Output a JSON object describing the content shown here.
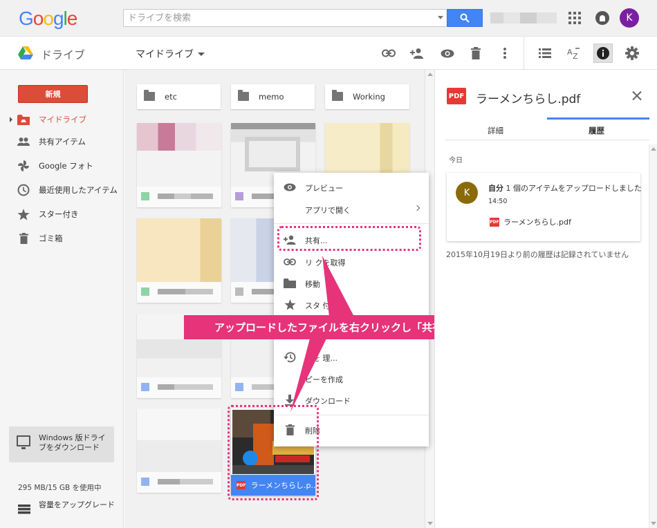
{
  "header": {
    "logo_letters": [
      {
        "ch": "G",
        "color": "#4285f4"
      },
      {
        "ch": "o",
        "color": "#ea4335"
      },
      {
        "ch": "o",
        "color": "#fbbc05"
      },
      {
        "ch": "g",
        "color": "#4285f4"
      },
      {
        "ch": "l",
        "color": "#34a853"
      },
      {
        "ch": "e",
        "color": "#ea4335"
      }
    ],
    "search_placeholder": "ドライブを検索",
    "avatar_letter": "K"
  },
  "toolbar": {
    "app_title": "ドライブ",
    "location": "マイドライブ",
    "icons": [
      "link-icon",
      "add-person-icon",
      "preview-eye-icon",
      "trash-icon",
      "more-vert-icon",
      "list-view-icon",
      "sort-az-icon",
      "info-icon",
      "settings-gear-icon"
    ]
  },
  "sidebar": {
    "new_label": "新規",
    "items": [
      {
        "label": "マイドライブ",
        "icon": "my-drive-icon",
        "active": true
      },
      {
        "label": "共有アイテム",
        "icon": "shared-people-icon",
        "active": false
      },
      {
        "label": "Google フォト",
        "icon": "photos-pinwheel-icon",
        "active": false
      },
      {
        "label": "最近使用したアイテム",
        "icon": "clock-icon",
        "active": false
      },
      {
        "label": "スター付き",
        "icon": "star-icon",
        "active": false
      },
      {
        "label": "ゴミ箱",
        "icon": "trash-icon",
        "active": false
      }
    ],
    "download_label": "Windows 版ドライブをダウンロード",
    "quota": "295 MB/15 GB を使用中",
    "upgrade_label": "容量をアップグレード"
  },
  "main": {
    "folders": [
      "etc",
      "memo",
      "Working"
    ],
    "selected_file": {
      "name": "ラーメンちらし.p...",
      "badge": "PDF"
    }
  },
  "context_menu": {
    "items": [
      {
        "label": "プレビュー",
        "icon": "eye-icon"
      },
      {
        "label": "アプリで開く",
        "icon": "",
        "submenu": true
      },
      {
        "label": "共有...",
        "icon": "add-person-icon"
      },
      {
        "label": "リンクを取得",
        "icon": "link-icon"
      },
      {
        "label": "移動",
        "icon": "folder-icon"
      },
      {
        "label": "スターを付ける",
        "icon": "star-icon"
      },
      {
        "label": "版を管理...",
        "icon": "history-icon"
      },
      {
        "label": "コピーを作成",
        "icon": "copy-icon"
      },
      {
        "label": "ダウンロード",
        "icon": "download-icon"
      },
      {
        "label": "削除",
        "icon": "trash-icon"
      }
    ],
    "visible_labels": {
      "preview": "プレビュー",
      "open_with": "アプリで開く",
      "share": "共有...",
      "get_link": "リ  クを取得",
      "move": "移動",
      "star": "スタ  付ける",
      "versions": "版を   理...",
      "copy": "  ピーを作成",
      "download": "ダウンロード",
      "delete": "削除"
    }
  },
  "annotation": {
    "text": "アップロードしたファイルを右クリックし「共有」をクリック",
    "color": "#e6337a"
  },
  "details": {
    "badge": "PDF",
    "title": "ラーメンちらし.pdf",
    "tabs": [
      "詳細",
      "履歴"
    ],
    "active_tab": "履歴",
    "section": "今日",
    "activity": {
      "avatar": "K",
      "actor": "自分",
      "action": " 1 個のアイテムをアップロードしました",
      "time": "14:50",
      "file": "ラーメンちらし.pdf",
      "file_badge": "PDF"
    },
    "note": "2015年10月19日より前の履歴は記録されていません"
  },
  "colors": {
    "accent_blue": "#4285f4",
    "new_red": "#dd4b39",
    "pdf_red": "#e53935",
    "annotation_pink": "#e6337a"
  }
}
